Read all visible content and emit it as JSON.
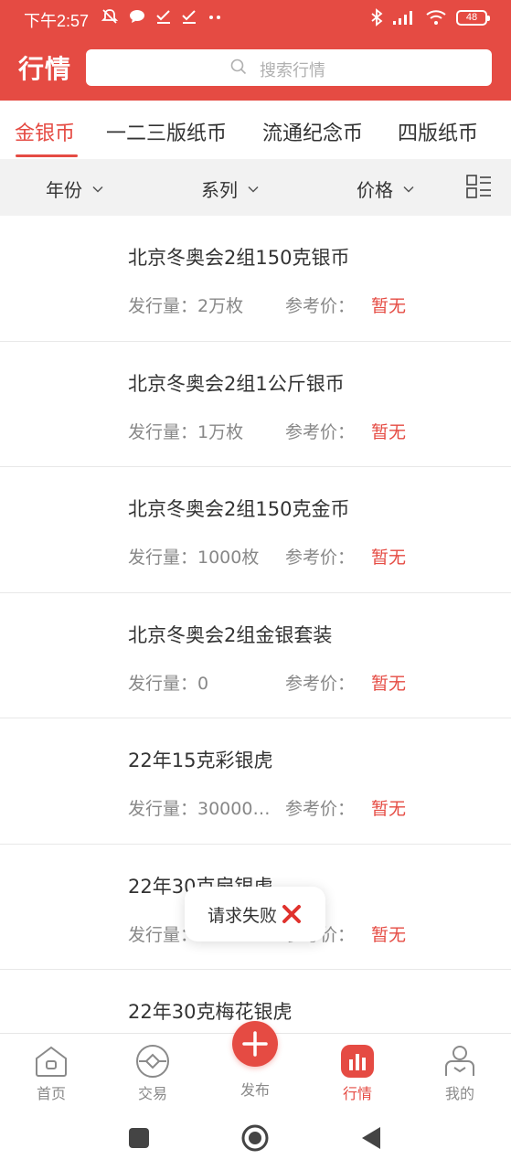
{
  "status": {
    "time": "下午2:57",
    "battery": "48",
    "left_icons": [
      "mute-icon",
      "message-icon",
      "check-icon",
      "check-icon",
      "more-dots-icon"
    ],
    "right_icons": [
      "bluetooth-icon",
      "signal-icon",
      "wifi-icon"
    ]
  },
  "header": {
    "title": "行情",
    "search_placeholder": "搜索行情"
  },
  "tabs": [
    {
      "label": "金银币",
      "active": true
    },
    {
      "label": "一二三版纸币",
      "active": false
    },
    {
      "label": "流通纪念币",
      "active": false
    },
    {
      "label": "四版纸币",
      "active": false
    }
  ],
  "filters": {
    "year": "年份",
    "series": "系列",
    "price": "价格"
  },
  "list": [
    {
      "title": "北京冬奥会2组150克银币",
      "issue": "发行量：2万枚",
      "ref_label": "参考价：",
      "price": "暂无"
    },
    {
      "title": "北京冬奥会2组1公斤银币",
      "issue": "发行量：1万枚",
      "ref_label": "参考价：",
      "price": "暂无"
    },
    {
      "title": "北京冬奥会2组150克金币",
      "issue": "发行量：1000枚",
      "ref_label": "参考价：",
      "price": "暂无"
    },
    {
      "title": "北京冬奥会2组金银套装",
      "issue": "发行量：0",
      "ref_label": "参考价：",
      "price": "暂无"
    },
    {
      "title": "22年15克彩银虎",
      "issue": "发行量：30000…",
      "ref_label": "参考价：",
      "price": "暂无"
    },
    {
      "title": "22年30克扇银虎",
      "issue": "发行量：",
      "ref_label": "参考价：",
      "price": "暂无"
    },
    {
      "title": "22年30克梅花银虎",
      "issue": "",
      "ref_label": "",
      "price": ""
    }
  ],
  "toast": {
    "text": "请求失败"
  },
  "bottom_nav": [
    {
      "label": "首页",
      "icon": "home-icon"
    },
    {
      "label": "交易",
      "icon": "trade-icon"
    },
    {
      "label": "发布",
      "icon": "plus-icon"
    },
    {
      "label": "行情",
      "icon": "chart-icon"
    },
    {
      "label": "我的",
      "icon": "profile-icon"
    }
  ],
  "colors": {
    "brand": "#e54b43",
    "price": "#e54b43",
    "muted": "#888888"
  }
}
